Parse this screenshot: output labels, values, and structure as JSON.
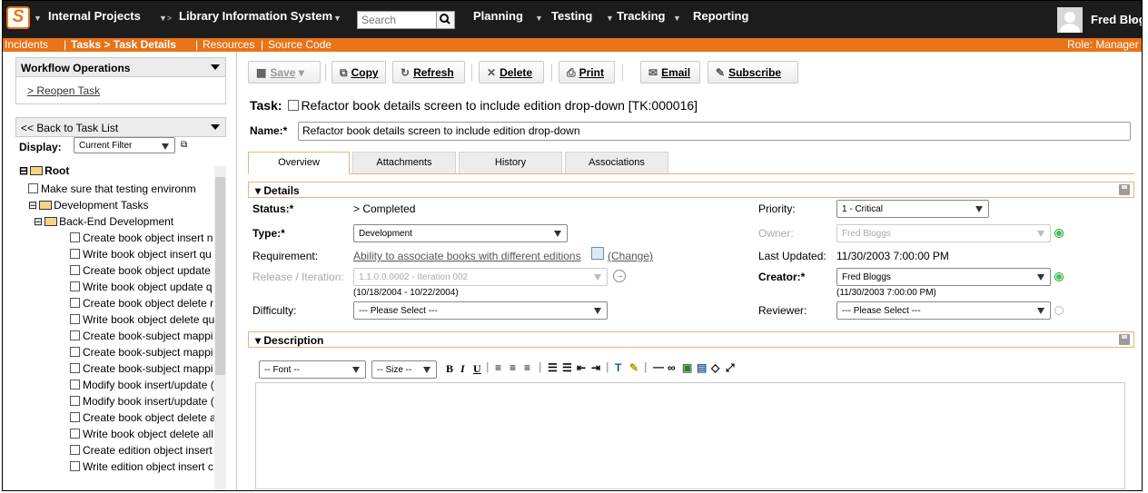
{
  "topnav": {
    "project": "Internal Projects",
    "project_arrow": "▼>",
    "product": "Library Information System",
    "search_placeholder": "Search",
    "menus": [
      "Planning",
      "Testing",
      "Tracking",
      "Reporting"
    ],
    "user": "Fred Bloggs"
  },
  "subnav": {
    "incidents": "Incidents",
    "tasks": "Tasks > Task Details",
    "resources": "Resources",
    "source_code": "Source Code",
    "role": "Role: Manager"
  },
  "sidebar": {
    "workflow_title": "Workflow Operations",
    "workflow_items": [
      "> Reopen Task"
    ],
    "back_link": "<< Back to Task List",
    "display_label": "Display:",
    "display_value": "Current Filter",
    "tree": [
      {
        "label": "Root",
        "type": "folder",
        "level": 0
      },
      {
        "label": "Make sure that testing environm",
        "type": "task",
        "level": 1
      },
      {
        "label": "Development Tasks",
        "type": "folder",
        "level": 1
      },
      {
        "label": "Back-End Development",
        "type": "folder",
        "level": 2
      },
      {
        "label": "Create book object insert n",
        "type": "task",
        "level": 3
      },
      {
        "label": "Write book object insert qu",
        "type": "task",
        "level": 3
      },
      {
        "label": "Create book object update",
        "type": "task",
        "level": 3
      },
      {
        "label": "Write book object update q",
        "type": "task",
        "level": 3
      },
      {
        "label": "Create book object delete r",
        "type": "task",
        "level": 3
      },
      {
        "label": "Write book object delete qu",
        "type": "task",
        "level": 3
      },
      {
        "label": "Create book-subject mappi",
        "type": "task",
        "level": 3
      },
      {
        "label": "Create book-subject mappi",
        "type": "task",
        "level": 3
      },
      {
        "label": "Create book-subject mappi",
        "type": "task",
        "level": 3
      },
      {
        "label": "Modify book insert/update (",
        "type": "task",
        "level": 3
      },
      {
        "label": "Modify book insert/update (",
        "type": "task",
        "level": 3
      },
      {
        "label": "Create book object delete a",
        "type": "task",
        "level": 3
      },
      {
        "label": "Write book object delete all",
        "type": "task",
        "level": 3
      },
      {
        "label": "Create edition object insert",
        "type": "task",
        "level": 3
      },
      {
        "label": "Write edition object insert c",
        "type": "task",
        "level": 3
      }
    ]
  },
  "toolbar": {
    "save": "Save",
    "copy": "Copy",
    "refresh": "Refresh",
    "delete": "Delete",
    "print": "Print",
    "email": "Email",
    "subscribe": "Subscribe"
  },
  "task": {
    "title_prefix": "Task:",
    "title": "Refactor book details screen to include edition drop-down [TK:000016]",
    "name_label": "Name:*",
    "name_value": "Refactor book details screen to include edition drop-down"
  },
  "tabs": [
    "Overview",
    "Attachments",
    "History",
    "Associations"
  ],
  "details": {
    "header": "Details",
    "status_label": "Status:*",
    "status_value": "> Completed",
    "type_label": "Type:*",
    "type_value": "Development",
    "requirement_label": "Requirement:",
    "requirement_value": "Ability to associate books with different editions",
    "requirement_change": "(Change)",
    "release_label": "Release / Iteration:",
    "release_value": "1.1.0.0.0002 - Iteration 002",
    "release_dates": "(10/18/2004 - 10/22/2004)",
    "difficulty_label": "Difficulty:",
    "difficulty_value": "--- Please Select ---",
    "priority_label": "Priority:",
    "priority_value": "1 - Critical",
    "owner_label": "Owner:",
    "owner_value": "Fred Bloggs",
    "last_updated_label": "Last Updated:",
    "last_updated_value": "11/30/2003 7:00:00 PM",
    "creator_label": "Creator:*",
    "creator_value": "Fred Bloggs",
    "creator_date": "(11/30/2003 7:00:00 PM)",
    "reviewer_label": "Reviewer:",
    "reviewer_value": "--- Please Select ---"
  },
  "description": {
    "header": "Description",
    "font_select": "-- Font --",
    "size_select": "-- Size --"
  },
  "colors": {
    "accent": "#e8731a",
    "topbar": "#1c1c1c"
  }
}
